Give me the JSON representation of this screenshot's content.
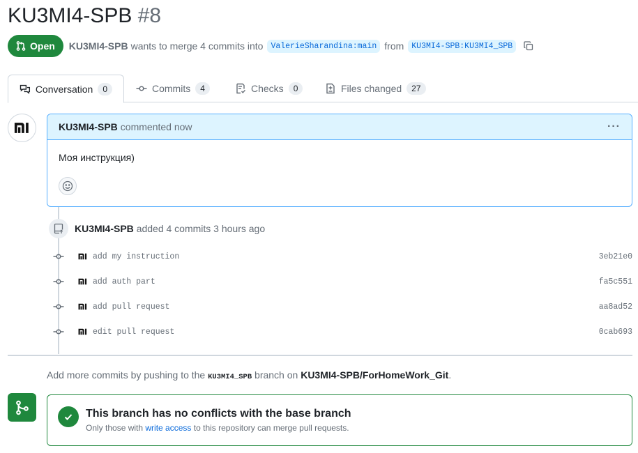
{
  "pr": {
    "title": "KU3MI4-SPB",
    "number": "#8",
    "state": "Open",
    "author": "KU3MI4-SPB",
    "action_text": "wants to merge 4 commits into",
    "base_branch": "ValerieSharandina:main",
    "from_text": "from",
    "head_branch": "KU3MI4-SPB:KU3MI4_SPB"
  },
  "tabs": [
    {
      "label": "Conversation",
      "count": "0",
      "icon": "comment-discussion-icon"
    },
    {
      "label": "Commits",
      "count": "4",
      "icon": "git-commit-icon"
    },
    {
      "label": "Checks",
      "count": "0",
      "icon": "checklist-icon"
    },
    {
      "label": "Files changed",
      "count": "27",
      "icon": "file-diff-icon"
    }
  ],
  "comment": {
    "author": "KU3MI4-SPB",
    "meta": "commented now",
    "body": "Моя инструкция)",
    "menu": "···"
  },
  "push_event": {
    "author": "KU3MI4-SPB",
    "text": "added 4 commits 3 hours ago"
  },
  "commits": [
    {
      "message": "add my instruction",
      "sha": "3eb21e0"
    },
    {
      "message": "add auth part",
      "sha": "fa5c551"
    },
    {
      "message": "add pull request",
      "sha": "aa8ad52"
    },
    {
      "message": "edit pull request",
      "sha": "0cab693"
    }
  ],
  "hint": {
    "prefix": "Add more commits by pushing to the",
    "branch": "KU3MI4_SPB",
    "middle": "branch on",
    "repo": "KU3MI4-SPB/ForHomeWork_Git",
    "suffix": "."
  },
  "merge": {
    "title": "This branch has no conflicts with the base branch",
    "sub_prefix": "Only those with",
    "sub_link": "write access",
    "sub_suffix": "to this repository can merge pull requests."
  },
  "colors": {
    "open_green": "#1f883d",
    "link_blue": "#0969da",
    "header_blue_bg": "#ddf4ff",
    "muted": "#656d76"
  }
}
